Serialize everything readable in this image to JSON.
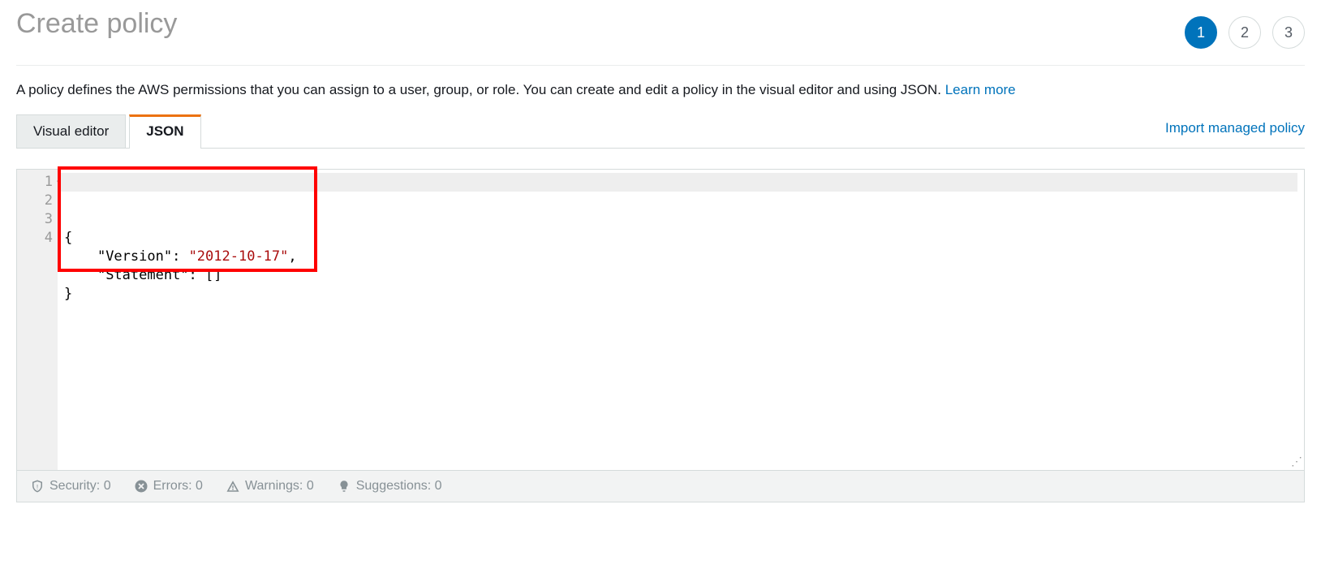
{
  "header": {
    "title": "Create policy",
    "steps": [
      "1",
      "2",
      "3"
    ],
    "activeStep": 0
  },
  "description": {
    "text": "A policy defines the AWS permissions that you can assign to a user, group, or role. You can create and edit a policy in the visual editor and using JSON. ",
    "learnMore": "Learn more"
  },
  "tabs": {
    "visual": "Visual editor",
    "json": "JSON",
    "importLink": "Import managed policy"
  },
  "editor": {
    "lineNumbers": [
      "1",
      "2",
      "3",
      "4"
    ],
    "code": {
      "l1": "{",
      "l2_indent": "    ",
      "l2_key": "\"Version\"",
      "l2_sep": ": ",
      "l2_val": "\"2012-10-17\"",
      "l2_end": ",",
      "l3_indent": "    ",
      "l3_key": "\"Statement\"",
      "l3_sep": ": ",
      "l3_val": "[]",
      "l4": "}"
    }
  },
  "statusBar": {
    "security": "Security: 0",
    "errors": "Errors: 0",
    "warnings": "Warnings: 0",
    "suggestions": "Suggestions: 0"
  }
}
